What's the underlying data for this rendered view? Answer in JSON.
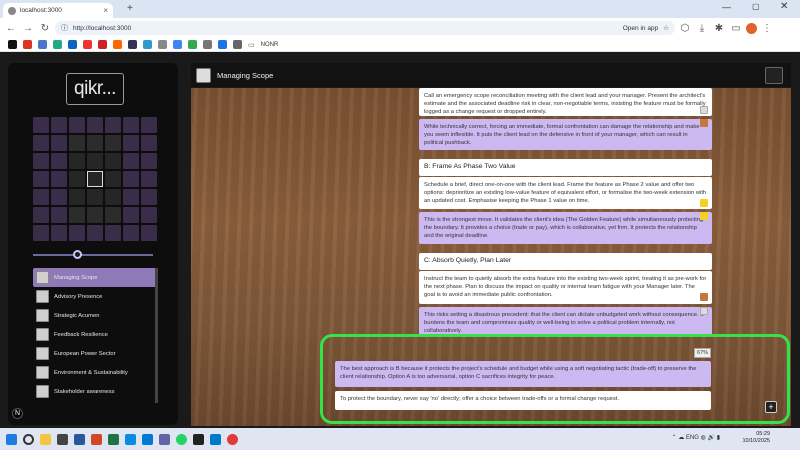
{
  "browser": {
    "tab_title": "localhost:3000",
    "tab_close": "×",
    "new_tab": "+",
    "url": "http://localhost:3000",
    "open_in_app": "Open in app",
    "bookmark_folder": "NONR"
  },
  "sidebar": {
    "logo": "qikr...",
    "items": [
      {
        "label": "Managing Scope",
        "active": true
      },
      {
        "label": "Advisory Presence"
      },
      {
        "label": "Strategic Acumen"
      },
      {
        "label": "Feedback Resilience"
      },
      {
        "label": "European Power Sector"
      },
      {
        "label": "Environment & Sustainability"
      },
      {
        "label": "Stakeholder awareness"
      }
    ],
    "bottom_icon": "N"
  },
  "header": {
    "title": "Managing Scope"
  },
  "cards": {
    "a_text": "Call an emergency scope reconciliation meeting with the client lead and your manager. Present the architect's estimate and the associated deadline risk in clear, non-negotiable terms, insisting the feature must be formally logged as a change request or dropped entirely.",
    "a_feedback": "While technically correct, forcing an immediate, formal confrontation can damage the relationship and make you seem inflexible. It puts the client lead on the defensive in front of your manager, which can result in political pushback.",
    "b_title": "B: Frame As Phase Two Value",
    "b_text": "Schedule a brief, direct one-on-one with the client lead. Frame the feature as Phase 2 value and offer two options: deprioritize an existing low-value feature of equivalent effort, or formalise the two-week extension with an updated cost. Emphasise keeping the Phase 1 value on time.",
    "b_feedback": "This is the strongest move. It validates the client's idea (The Golden Feature) while simultaneously protecting the boundary. It provides a choice (trade or pay), which is collaborative, yet firm. It protects the relationship and the original deadline.",
    "c_title": "C: Absorb Quietly, Plan Later",
    "c_text": "Instruct the team to quietly absorb the extra feature into the existing two-week sprint, treating it as pre-work for the next phase. Plan to discuss the impact on quality or internal team fatigue with your Manager later. The goal is to avoid an immediate public confrontation.",
    "c_feedback": "This risks setting a disastrous precedent: that the client can dictate unbudgeted work without consequence. It burdens the team and compromises quality or well-being to solve a political problem internally, not collaboratively."
  },
  "result": {
    "percent": "67%",
    "explanation": "The best approach is B because it protects the project's schedule and budget while using a soft negotiating tactic (trade-off) to preserve the client relationship. Option A is too adversarial, option C sacrifices integrity for peace.",
    "tip": "To protect the boundary, never say 'no' directly; offer a choice between trade-offs or a formal change request.",
    "add_button": "+"
  },
  "taskbar": {
    "time": "05:29",
    "date": "10/10/2025",
    "lang": "ENG"
  },
  "colors": {
    "accent_purple": "#8e7ab8",
    "feedback_purple": "#cdb9f1",
    "highlight_green": "#34e34a"
  }
}
